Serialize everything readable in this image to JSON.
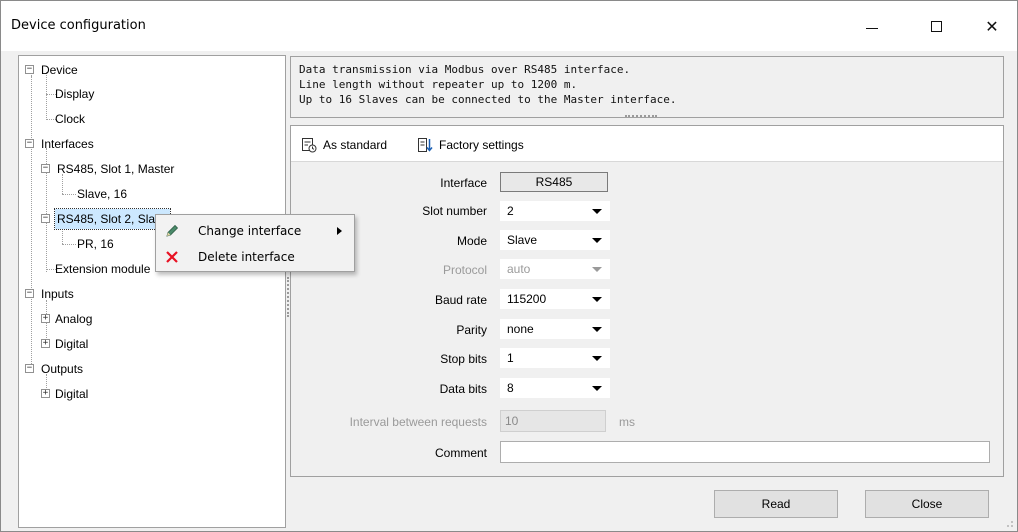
{
  "window": {
    "title": "Device configuration",
    "controls": {
      "minimize": "minimize",
      "maximize": "maximize",
      "close": "✕"
    }
  },
  "tree": {
    "items": [
      {
        "label": "Device",
        "expander": "−"
      },
      {
        "label": "Display"
      },
      {
        "label": "Clock"
      },
      {
        "label": "Interfaces",
        "expander": "−"
      },
      {
        "label": "RS485, Slot 1, Master",
        "expander": "−"
      },
      {
        "label": "Slave, 16"
      },
      {
        "label": "RS485, Slot 2, Slave",
        "expander": "−",
        "selected": true
      },
      {
        "label": "PR, 16"
      },
      {
        "label": "Extension module"
      },
      {
        "label": "Inputs",
        "expander": "−"
      },
      {
        "label": "Analog",
        "expander": "+"
      },
      {
        "label": "Digital",
        "expander": "+"
      },
      {
        "label": "Outputs",
        "expander": "−"
      },
      {
        "label": "Digital",
        "expander": "+"
      }
    ]
  },
  "info": {
    "lines": [
      "Data transmission via Modbus over RS485 interface.",
      "Line length without repeater up to 1200 m.",
      "Up to 16 Slaves can be connected to the Master interface."
    ]
  },
  "toolbar": {
    "as_standard": "As standard",
    "factory_settings": "Factory settings"
  },
  "form": {
    "interface": {
      "label": "Interface",
      "value": "RS485"
    },
    "slot_number": {
      "label": "Slot number",
      "value": "2"
    },
    "mode": {
      "label": "Mode",
      "value": "Slave"
    },
    "protocol": {
      "label": "Protocol",
      "value": "auto"
    },
    "baud_rate": {
      "label": "Baud rate",
      "value": "115200"
    },
    "parity": {
      "label": "Parity",
      "value": "none"
    },
    "stop_bits": {
      "label": "Stop bits",
      "value": "1"
    },
    "data_bits": {
      "label": "Data bits",
      "value": "8"
    },
    "interval": {
      "label": "Interval between requests",
      "value": "10",
      "unit": "ms"
    },
    "comment": {
      "label": "Comment",
      "value": ""
    }
  },
  "buttons": {
    "read": "Read",
    "close": "Close"
  },
  "context_menu": {
    "items": [
      {
        "label": "Change interface",
        "icon": "pencil-icon",
        "has_submenu": true
      },
      {
        "label": "Delete interface",
        "icon": "red-x-icon"
      }
    ]
  },
  "colors": {
    "accent_selected": "#cce8ff",
    "delete_red": "#e81123",
    "pencil_green": "#4a8a6a"
  }
}
